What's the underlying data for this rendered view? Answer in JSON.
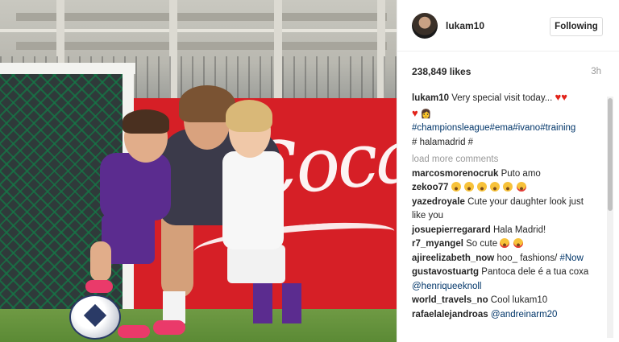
{
  "post": {
    "username": "lukam10",
    "follow_label": "Following",
    "likes": "238,849 likes",
    "time": "3h"
  },
  "caption": {
    "user": "lukam10",
    "text": "Very special visit today...",
    "hashtags": "#championsleague#ema#ivano#training",
    "line3": "# halamadrid #"
  },
  "load_more": "load more comments",
  "comments": [
    {
      "user": "marcosmorenocruk",
      "text": "Puto amo"
    },
    {
      "user": "zekoo77",
      "text": ""
    },
    {
      "user": "yazedroyale",
      "text": "Cute your daughter look just like you"
    },
    {
      "user": "josuepierregarard",
      "text": "Hala Madrid!"
    },
    {
      "user": "r7_myangel",
      "text": "So cute"
    },
    {
      "user": "ajireelizabeth_now",
      "text": "hoo_ fashions/",
      "tag": "#Now"
    },
    {
      "user": "gustavostuartg",
      "text": "Pantoca dele é a tua coxa",
      "tag": "@henriqueeknoll"
    },
    {
      "user": "world_travels_no",
      "text": "Cool lukam10"
    },
    {
      "user": "rafaelalejandroas",
      "text": "",
      "tag": "@andreinarm20"
    }
  ],
  "colors": {
    "link": "#003569",
    "muted": "#999999",
    "heart": "#e2231a"
  },
  "icons": [
    "heart-icon",
    "smile-emoji-icon",
    "heart-eyes-emoji-icon"
  ]
}
